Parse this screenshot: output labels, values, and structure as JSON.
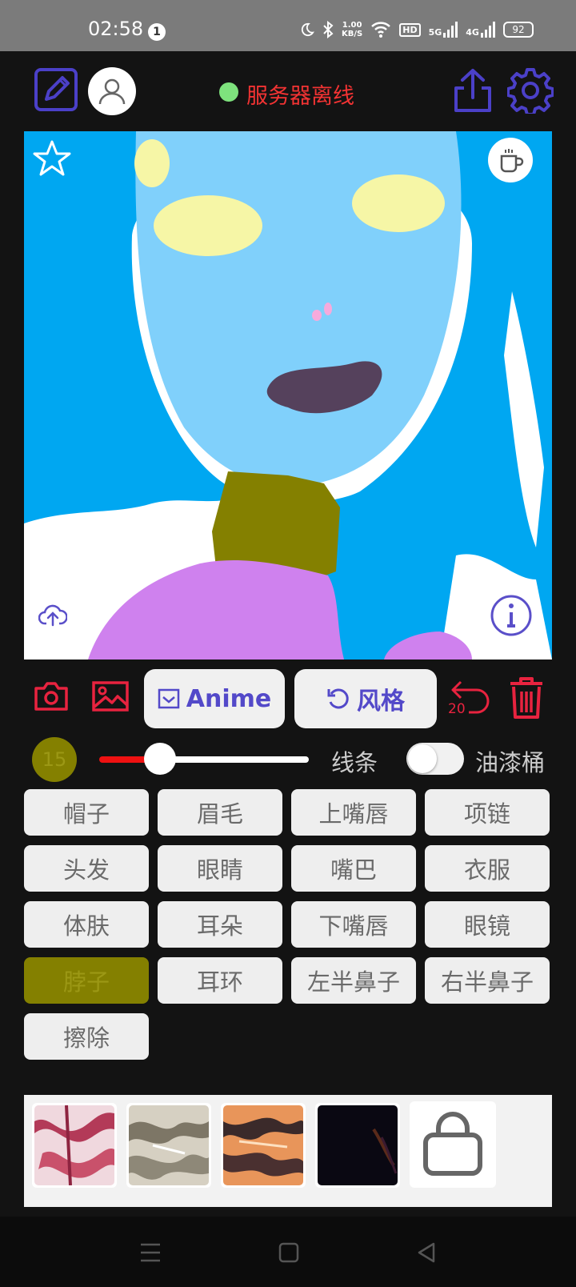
{
  "status_bar": {
    "time": "02:58",
    "notification_count": "1",
    "speed_value": "1.00",
    "speed_unit": "KB/S",
    "hd_label": "HD",
    "net1": "5G",
    "net2": "4G",
    "battery": "92"
  },
  "header": {
    "server_status": "服务器离线",
    "server_status_color": "#f33333",
    "online_dot_color": "#7ee27d"
  },
  "toolbar": {
    "anime_label": "Anime",
    "style_label": "风格",
    "undo_count": "20",
    "accent_color": "#e8233f",
    "button_text_color": "#5349c9"
  },
  "brush": {
    "size": "15",
    "line_label": "线条",
    "bucket_label": "油漆桶",
    "bucket_enabled": false,
    "size_fraction": 0.28
  },
  "parts": [
    "帽子",
    "眉毛",
    "上嘴唇",
    "项链",
    "头发",
    "眼睛",
    "嘴巴",
    "衣服",
    "体肤",
    "耳朵",
    "下嘴唇",
    "眼镜",
    "脖子",
    "耳环",
    "左半鼻子",
    "右半鼻子",
    "擦除"
  ],
  "selected_part": "脖子",
  "style_thumbnails": [
    "pink-marble",
    "silver-marble",
    "orange-marble",
    "dark-texture",
    "store-bag-icon"
  ]
}
